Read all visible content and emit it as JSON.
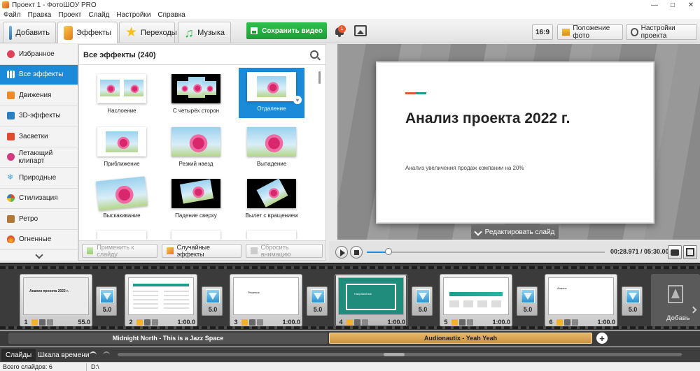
{
  "window": {
    "title": "Проект 1 - ФотоШОУ PRO",
    "controls": [
      "—",
      "□",
      "✕"
    ]
  },
  "menu": [
    "Файл",
    "Правка",
    "Проект",
    "Слайд",
    "Настройки",
    "Справка"
  ],
  "toolbar": {
    "tabs": [
      {
        "label": "Добавить",
        "icon": "folder-icon",
        "color": "#3a86c8"
      },
      {
        "label": "Эффекты",
        "icon": "brush-icon",
        "color": "#f4a61d"
      },
      {
        "label": "Переходы",
        "icon": "star-icon",
        "color": "#f6c01a"
      },
      {
        "label": "Музыка",
        "icon": "music-note-icon",
        "color": "#34b34a"
      }
    ],
    "save_label": "Сохранить видео",
    "notification_count": "1",
    "ratio_label": "16:9",
    "photo_position_label": "Положение фото",
    "project_settings_label": "Настройки проекта"
  },
  "categories": [
    {
      "label": "Избранное",
      "color": "#e0415a"
    },
    {
      "label": "Все эффекты",
      "color": "#1b5fa3"
    },
    {
      "label": "Движения",
      "color": "#f08a24"
    },
    {
      "label": "3D-эффекты",
      "color": "#2a7fc2"
    },
    {
      "label": "Засветки",
      "color": "#e24a2c"
    },
    {
      "label": "Летающий клипарт",
      "color": "#d43c80"
    },
    {
      "label": "Природные",
      "color": "#3aa0e0"
    },
    {
      "label": "Стилизация",
      "color": "#5ab848"
    },
    {
      "label": "Ретро",
      "color": "#b0793a"
    },
    {
      "label": "Огненные",
      "color": "#e2542a"
    }
  ],
  "effects_panel": {
    "title": "Все эффекты (240)",
    "items": [
      {
        "label": "Наслоение"
      },
      {
        "label": "С четырёх сторон"
      },
      {
        "label": "Отдаление"
      },
      {
        "label": "Приближение"
      },
      {
        "label": "Резкий наезд"
      },
      {
        "label": "Выпадение"
      },
      {
        "label": "Выскакивание"
      },
      {
        "label": "Падение сверху"
      },
      {
        "label": "Вылет с вращением"
      }
    ],
    "apply_label": "Применить к слайду",
    "random_label": "Случайные эффекты",
    "reset_label": "Сбросить анимацию"
  },
  "preview": {
    "slide_title": "Анализ проекта 2022 г.",
    "slide_subtitle": "Анализ увеличения продаж компании на 20%",
    "edit_label": "Редактировать слайд",
    "time": "00:28.971 / 05:30.000",
    "progress": 0.09
  },
  "timeline": {
    "slides": [
      {
        "num": "1",
        "duration": "55.0",
        "thumb_title": "Анализ проекта 2022 г."
      },
      {
        "num": "2",
        "duration": "1:00.0"
      },
      {
        "num": "3",
        "duration": "1:00.0",
        "thumb_title": "Решение"
      },
      {
        "num": "4",
        "duration": "1:00.0",
        "thumb_title": "Направление"
      },
      {
        "num": "5",
        "duration": "1:00.0"
      },
      {
        "num": "6",
        "duration": "1:00.0",
        "thumb_title": "Анализ"
      }
    ],
    "transitions": [
      "5.0",
      "5.0",
      "5.0",
      "5.0",
      "5.0",
      "5.0"
    ],
    "add_label": "Добавь"
  },
  "audio": {
    "track1": "Midnight North - This is a Jazz Space",
    "track2": "Audionautix - Yeah Yeah"
  },
  "bottom_tabs": {
    "slides": "Слайды",
    "timeline": "Шкала времени"
  },
  "status": {
    "total": "Всего слайдов: 6",
    "path": "D:\\"
  }
}
